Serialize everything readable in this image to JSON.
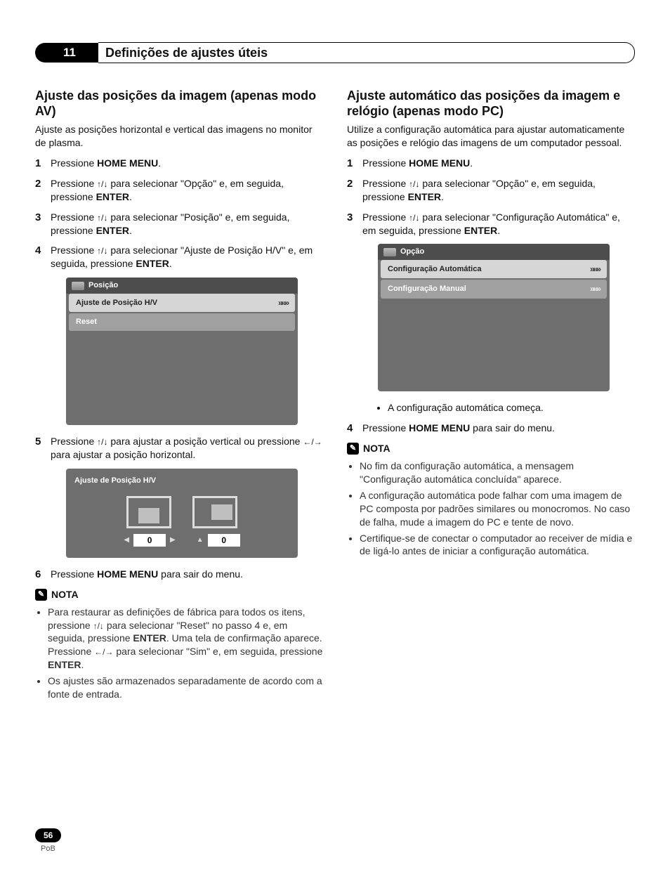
{
  "chapter": {
    "number": "11",
    "title": "Definições de ajustes úteis"
  },
  "page": {
    "number": "56",
    "lang": "PoB"
  },
  "keys": {
    "home_menu": "HOME MENU",
    "enter": "ENTER"
  },
  "left": {
    "heading": "Ajuste das posições da imagem (apenas modo AV)",
    "intro": "Ajuste as posições horizontal e vertical das imagens no monitor de plasma.",
    "steps": {
      "s1": {
        "pre": "Pressione "
      },
      "s2": {
        "pre": "Pressione ",
        "mid": " para selecionar \"Opção\" e, em seguida, pressione "
      },
      "s3": {
        "pre": "Pressione ",
        "mid": " para selecionar \"Posição\" e, em seguida, pressione "
      },
      "s4": {
        "pre": "Pressione ",
        "mid": " para selecionar \"Ajuste de Posição H/V\" e, em seguida, pressione "
      },
      "s5": {
        "pre": "Pressione ",
        "mid": " para ajustar a posição vertical ou pressione ",
        "mid2": " para ajustar a posição horizontal."
      },
      "s6": {
        "pre": "Pressione ",
        "post": " para sair do menu."
      }
    },
    "osd": {
      "title": "Posição",
      "row_selected": "Ajuste de Posição H/V",
      "row_reset": "Reset",
      "chevron": "»»»"
    },
    "hv": {
      "title": "Ajuste de Posição H/V",
      "val_v": "0",
      "val_h": "0"
    },
    "note_label": "NOTA",
    "notes": {
      "n1_a": "Para restaurar as definições de fábrica para todos os itens, pressione ",
      "n1_b": " para selecionar \"Reset\" no passo 4 e, em seguida, pressione ",
      "n1_c": ". Uma tela de confirmação aparece. Pressione ",
      "n1_d": " para selecionar \"Sim\" e, em seguida, pressione ",
      "n2": "Os ajustes são armazenados separadamente de acordo com a fonte de entrada."
    }
  },
  "right": {
    "heading": "Ajuste automático das posições da imagem e relógio (apenas modo PC)",
    "intro": "Utilize a configuração automática para ajustar automaticamente as posições e relógio das imagens de um computador pessoal.",
    "steps": {
      "s1": {
        "pre": "Pressione "
      },
      "s2": {
        "pre": "Pressione ",
        "mid": " para selecionar \"Opção\" e, em seguida, pressione "
      },
      "s3": {
        "pre": "Pressione ",
        "mid": " para selecionar \"Configuração Automática\" e, em seguida, pressione "
      }
    },
    "osd": {
      "title": "Opção",
      "row_selected": "Configuração Automática",
      "row_manual": "Configuração Manual",
      "chevron": "»»»"
    },
    "sub_bullet": "A configuração automática começa.",
    "step4": {
      "pre": "Pressione ",
      "post": " para sair do menu."
    },
    "note_label": "NOTA",
    "notes": {
      "n1": "No fim da configuração automática, a mensagem \"Configuração automática concluída\" aparece.",
      "n2": "A configuração automática pode falhar com uma imagem de PC composta por padrões similares ou monocromos. No caso de falha, mude a imagem do PC e tente de novo.",
      "n3": "Certifique-se de conectar o computador ao receiver de mídia e de ligá-lo antes de iniciar a configuração automática."
    }
  }
}
